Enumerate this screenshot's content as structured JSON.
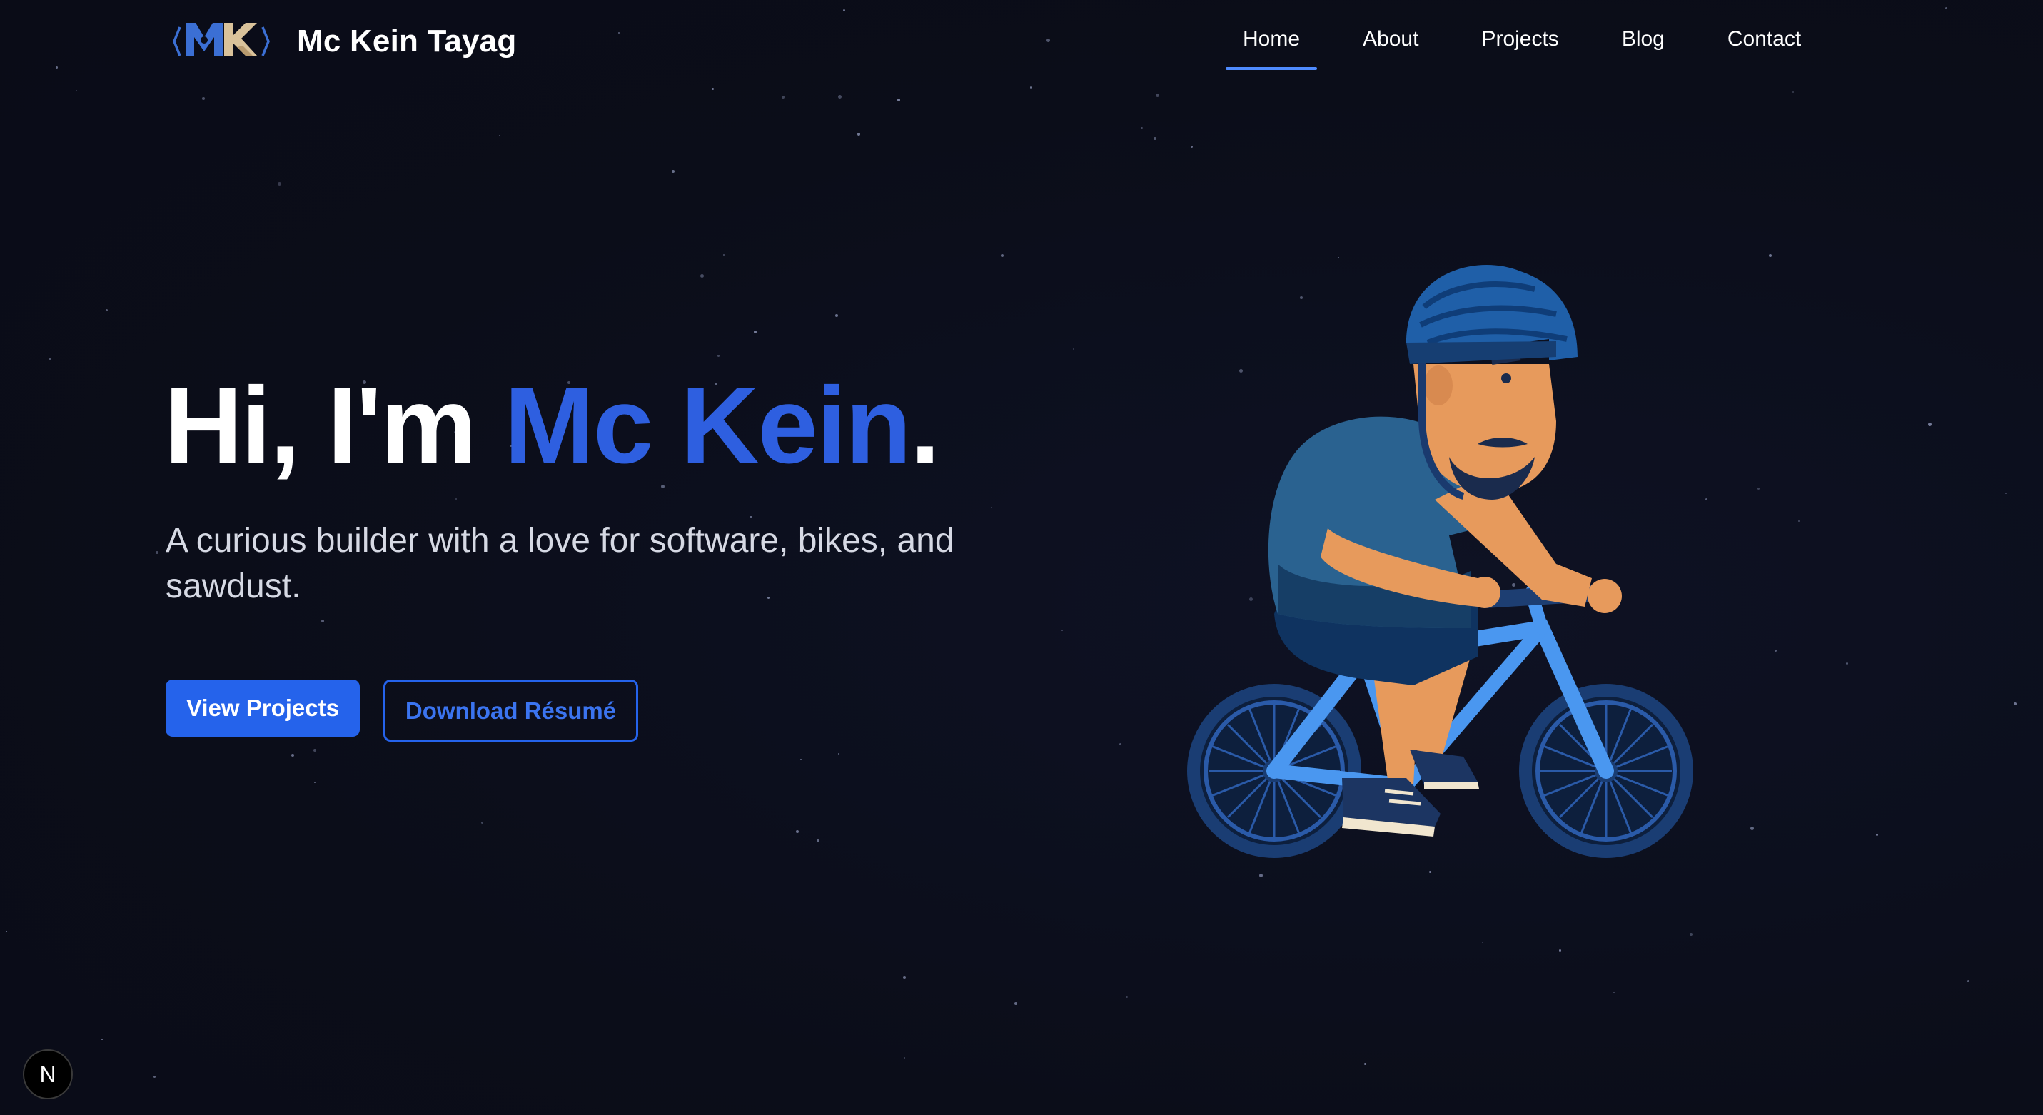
{
  "header": {
    "brand_name": "Mc Kein Tayag",
    "logo_text": "MK"
  },
  "nav": {
    "items": [
      {
        "label": "Home",
        "active": true
      },
      {
        "label": "About",
        "active": false
      },
      {
        "label": "Projects",
        "active": false
      },
      {
        "label": "Blog",
        "active": false
      },
      {
        "label": "Contact",
        "active": false
      }
    ]
  },
  "hero": {
    "title_prefix": "Hi, I'm ",
    "title_name": "Mc Kein",
    "title_suffix": ".",
    "subtitle": "A curious builder with a love for software, bikes, and sawdust.",
    "primary_button": "View Projects",
    "secondary_button": "Download Résumé"
  },
  "dev_badge": {
    "label": "N"
  },
  "colors": {
    "background": "#0b0d19",
    "accent": "#2e5fe0",
    "button": "#2563eb",
    "nav_underline": "#4f8bff"
  }
}
